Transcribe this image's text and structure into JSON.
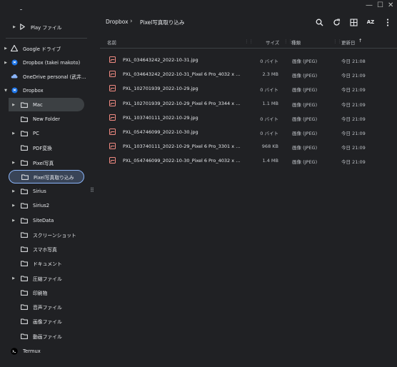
{
  "window": {
    "minimize_glyph": "—",
    "maximize_glyph": "☐",
    "close_glyph": "✕"
  },
  "sidebar": {
    "items": [
      {
        "label": "Play ファイル",
        "icon": "play-icon",
        "expandable": true
      },
      {
        "label": "Google ドライブ",
        "icon": "google-drive-icon",
        "expandable": true
      },
      {
        "label": "Dropbox (takei makoto)",
        "icon": "dropbox-icon",
        "expandable": true
      },
      {
        "label": "OneDrive personal (武井 ...",
        "icon": "onedrive-icon",
        "expandable": false
      },
      {
        "label": "Dropbox",
        "icon": "dropbox-icon",
        "expandable": true,
        "expanded": true
      },
      {
        "label": "Mac",
        "icon": "folder-icon",
        "expandable": true,
        "selected": true
      },
      {
        "label": "New Folder",
        "icon": "folder-icon",
        "expandable": false
      },
      {
        "label": "PC",
        "icon": "folder-icon",
        "expandable": true
      },
      {
        "label": "PDF変換",
        "icon": "folder-icon",
        "expandable": false
      },
      {
        "label": "Pixel写真",
        "icon": "folder-icon",
        "expandable": true
      },
      {
        "label": "Pixel写真取り込み",
        "icon": "folder-icon",
        "expandable": false,
        "active": true
      },
      {
        "label": "Sirius",
        "icon": "folder-icon",
        "expandable": true
      },
      {
        "label": "Sirius2",
        "icon": "folder-icon",
        "expandable": true
      },
      {
        "label": "SiteData",
        "icon": "folder-icon",
        "expandable": true
      },
      {
        "label": "スクリーンショット",
        "icon": "folder-icon",
        "expandable": false
      },
      {
        "label": "スマホ写真",
        "icon": "folder-icon",
        "expandable": false
      },
      {
        "label": "ドキュメント",
        "icon": "folder-icon",
        "expandable": false
      },
      {
        "label": "圧縮ファイル",
        "icon": "folder-icon",
        "expandable": true
      },
      {
        "label": "印刷物",
        "icon": "folder-icon",
        "expandable": false
      },
      {
        "label": "音声ファイル",
        "icon": "folder-icon",
        "expandable": false
      },
      {
        "label": "画像ファイル",
        "icon": "folder-icon",
        "expandable": false
      },
      {
        "label": "動画ファイル",
        "icon": "folder-icon",
        "expandable": false
      },
      {
        "label": "Termux",
        "icon": "termux-icon",
        "expandable": false
      }
    ],
    "resize_handle_glyph": "⠿"
  },
  "toolbar": {
    "breadcrumb": [
      "Dropbox",
      "Pixel写真取り込み"
    ],
    "breadcrumb_separator": "›",
    "icons": [
      "search-icon",
      "refresh-icon",
      "grid-view-icon",
      "sort-az-icon",
      "more-vert-icon"
    ],
    "sort_label": "AZ"
  },
  "table": {
    "headers": {
      "name": "名前",
      "size": "サイズ",
      "type": "種類",
      "date": "更新日"
    },
    "sort_arrow": "↑",
    "rows": [
      {
        "name": "PXL_034643242_2022-10-31.jpg",
        "size": "0 バイト",
        "type": "画像 (JPEG)",
        "date": "今日 21:08"
      },
      {
        "name": "PXL_034643242_2022-10-31_Pixel 6 Pro_4032 x 2268.j...",
        "size": "2.3 MB",
        "type": "画像 (JPEG)",
        "date": "今日 21:09"
      },
      {
        "name": "PXL_102701939_2022-10-29.jpg",
        "size": "0 バイト",
        "type": "画像 (JPEG)",
        "date": "今日 21:09"
      },
      {
        "name": "PXL_102701939_2022-10-29_Pixel 6 Pro_3344 x 1982.j...",
        "size": "1.1 MB",
        "type": "画像 (JPEG)",
        "date": "今日 21:09"
      },
      {
        "name": "PXL_103740111_2022-10-29.jpg",
        "size": "0 バイト",
        "type": "画像 (JPEG)",
        "date": "今日 21:09"
      },
      {
        "name": "PXL_054746099_2022-10-30.jpg",
        "size": "0 バイト",
        "type": "画像 (JPEG)",
        "date": "今日 21:09"
      },
      {
        "name": "PXL_103740111_2022-10-29_Pixel 6 Pro_3301 x 1857.j...",
        "size": "968 KB",
        "type": "画像 (JPEG)",
        "date": "今日 21:09"
      },
      {
        "name": "PXL_054746099_2022-10-30_Pixel 6 Pro_4032 x 2268.j...",
        "size": "1.4 MB",
        "type": "画像 (JPEG)",
        "date": "今日 21:09"
      }
    ]
  },
  "colors": {
    "background": "#202124",
    "selected_bg": "#3c4043",
    "active_border": "#8ab4f8",
    "image_icon": "#f28b82",
    "dropbox_icon": "#1a73e8"
  }
}
